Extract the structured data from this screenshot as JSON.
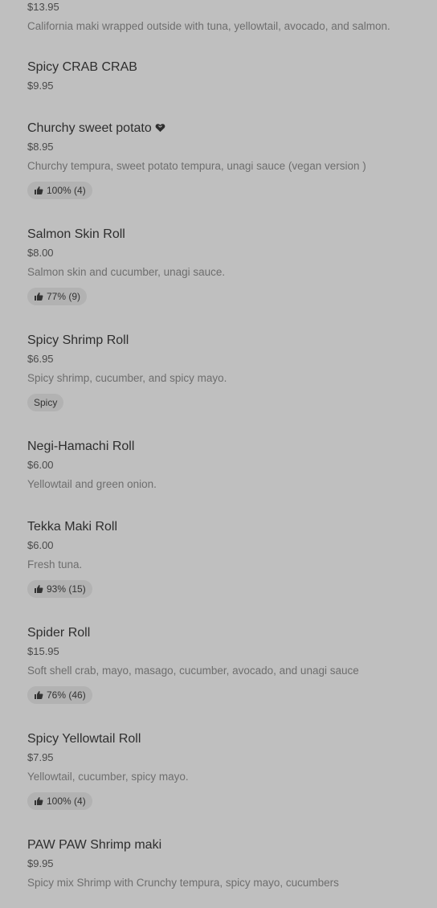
{
  "items": [
    {
      "price": "$13.95",
      "description": "California maki wrapped outside with tuna, yellowtail, avocado, and salmon."
    },
    {
      "name": "Spicy CRAB CRAB",
      "price": "$9.95"
    },
    {
      "name": "Churchy sweet potato",
      "icon": "heart-icon",
      "price": "$8.95",
      "description": "Churchy tempura, sweet potato tempura, unagi sauce (vegan version )",
      "rating": "100% (4)"
    },
    {
      "name": "Salmon Skin Roll",
      "price": "$8.00",
      "description": "Salmon skin and cucumber, unagi sauce.",
      "rating": "77% (9)"
    },
    {
      "name": "Spicy Shrimp Roll",
      "price": "$6.95",
      "description": "Spicy shrimp, cucumber, and spicy mayo.",
      "tag": "Spicy"
    },
    {
      "name": "Negi-Hamachi Roll",
      "price": "$6.00",
      "description": "Yellowtail and green onion."
    },
    {
      "name": "Tekka Maki Roll",
      "price": "$6.00",
      "description": "Fresh tuna.",
      "rating": "93% (15)"
    },
    {
      "name": "Spider Roll",
      "price": "$15.95",
      "description": "Soft shell crab, mayo, masago, cucumber, avocado, and unagi sauce",
      "rating": "76% (46)"
    },
    {
      "name": "Spicy Yellowtail Roll",
      "price": "$7.95",
      "description": "Yellowtail, cucumber, spicy mayo.",
      "rating": "100% (4)"
    },
    {
      "name": "PAW PAW Shrimp maki",
      "price": "$9.95",
      "description": "Spicy mix Shrimp with Crunchy tempura, spicy mayo, cucumbers"
    }
  ],
  "colors": {
    "background": "#bfbfbf",
    "badge": "#b2b2b2"
  }
}
